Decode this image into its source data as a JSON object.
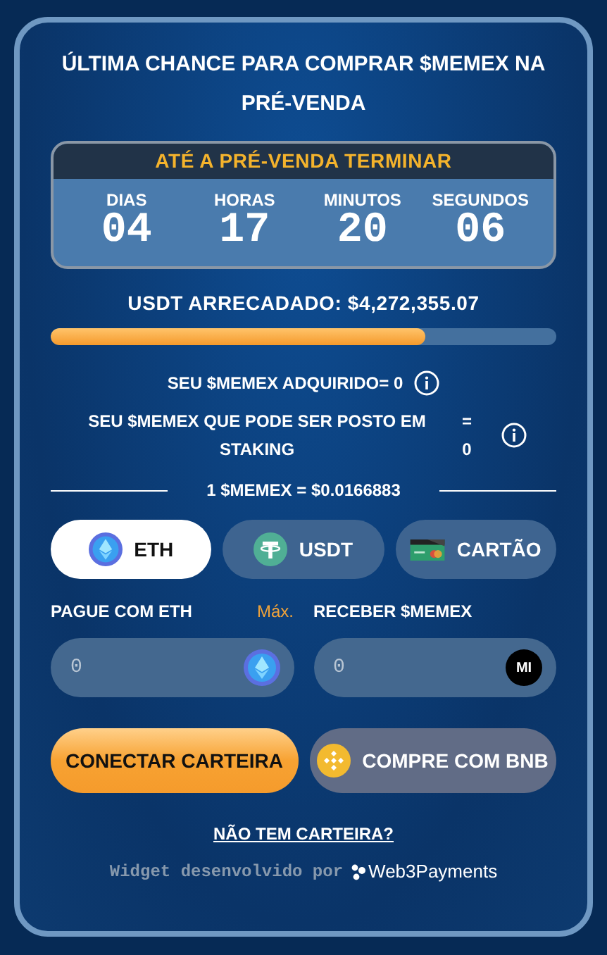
{
  "title": "ÚLTIMA CHANCE PARA COMPRAR $MEMEX NA PRÉ-VENDA",
  "countdown": {
    "heading": "ATÉ A PRÉ-VENDA TERMINAR",
    "units": [
      {
        "label": "DIAS",
        "value": "04"
      },
      {
        "label": "HORAS",
        "value": "17"
      },
      {
        "label": "MINUTOS",
        "value": "20"
      },
      {
        "label": "SEGUNDOS",
        "value": "06"
      }
    ]
  },
  "raised": {
    "text": "USDT ARRECADADO: $4,272,355.07",
    "level": 0.74
  },
  "purchased": {
    "label": "SEU $MEMEX ADQUIRIDO= 0"
  },
  "stakeable": {
    "label": "SEU $MEMEX QUE PODE SER POSTO EM STAKING",
    "value": "= 0"
  },
  "price": "1 $MEMEX = $0.0166883",
  "tabs": [
    {
      "label": "ETH",
      "kind": "eth",
      "selected": true
    },
    {
      "label": "USDT",
      "kind": "usdt",
      "selected": false
    },
    {
      "label": "CARTÃO",
      "kind": "card",
      "selected": false
    }
  ],
  "pay": {
    "label": "PAGUE COM ETH",
    "max": "Máx.",
    "placeholder": "0"
  },
  "receive": {
    "label": "RECEBER $MEMEX",
    "placeholder": "0",
    "token_badge": "MI"
  },
  "buttons": {
    "connect": "CONECTAR CARTEIRA",
    "bnb": "COMPRE COM BNB"
  },
  "no_wallet_link": "NÃO TEM CARTEIRA?",
  "footer": {
    "text": "Widget desenvolvido por",
    "brand": "Web3Payments"
  }
}
